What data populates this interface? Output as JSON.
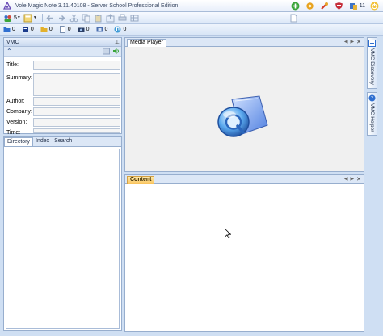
{
  "window": {
    "title": "Vole Magic Note  3.11.40108 - Server School Professional Edition",
    "notification_count": "11"
  },
  "toolbar": {
    "users_count": "5"
  },
  "stats": [
    {
      "icon": "folder-icon",
      "value": "0",
      "color": "#2f6fd0"
    },
    {
      "icon": "note-icon",
      "value": "0",
      "color": "#1c3c8c"
    },
    {
      "icon": "yellow-folder-icon",
      "value": "0",
      "color": "#e3b12c"
    },
    {
      "icon": "page-icon",
      "value": "0",
      "color": "#7a90b0"
    },
    {
      "icon": "camera-icon",
      "value": "0",
      "color": "#2b3f66"
    },
    {
      "icon": "film-icon",
      "value": "0",
      "color": "#4a6fb0"
    },
    {
      "icon": "audio-icon",
      "value": "0",
      "color": "#3c9ad6"
    }
  ],
  "vmc_panel": {
    "title": "VMC",
    "labels": {
      "title": "Title:",
      "summary": "Summary:",
      "author": "Author:",
      "company": "Company:",
      "version": "Version:",
      "time": "Time:"
    }
  },
  "directory_panel": {
    "tabs": [
      "Directory",
      "Index",
      "Search"
    ],
    "active_tab": "Directory"
  },
  "media_panel": {
    "tab": "Media Player"
  },
  "content_panel": {
    "tab": "Content"
  },
  "side_tabs": [
    "VMC Discovery",
    "VMC Helper"
  ],
  "colors": {
    "accent": "#2f6fd0",
    "panel_border": "#97aece",
    "content_tab": "#f9c25a"
  }
}
